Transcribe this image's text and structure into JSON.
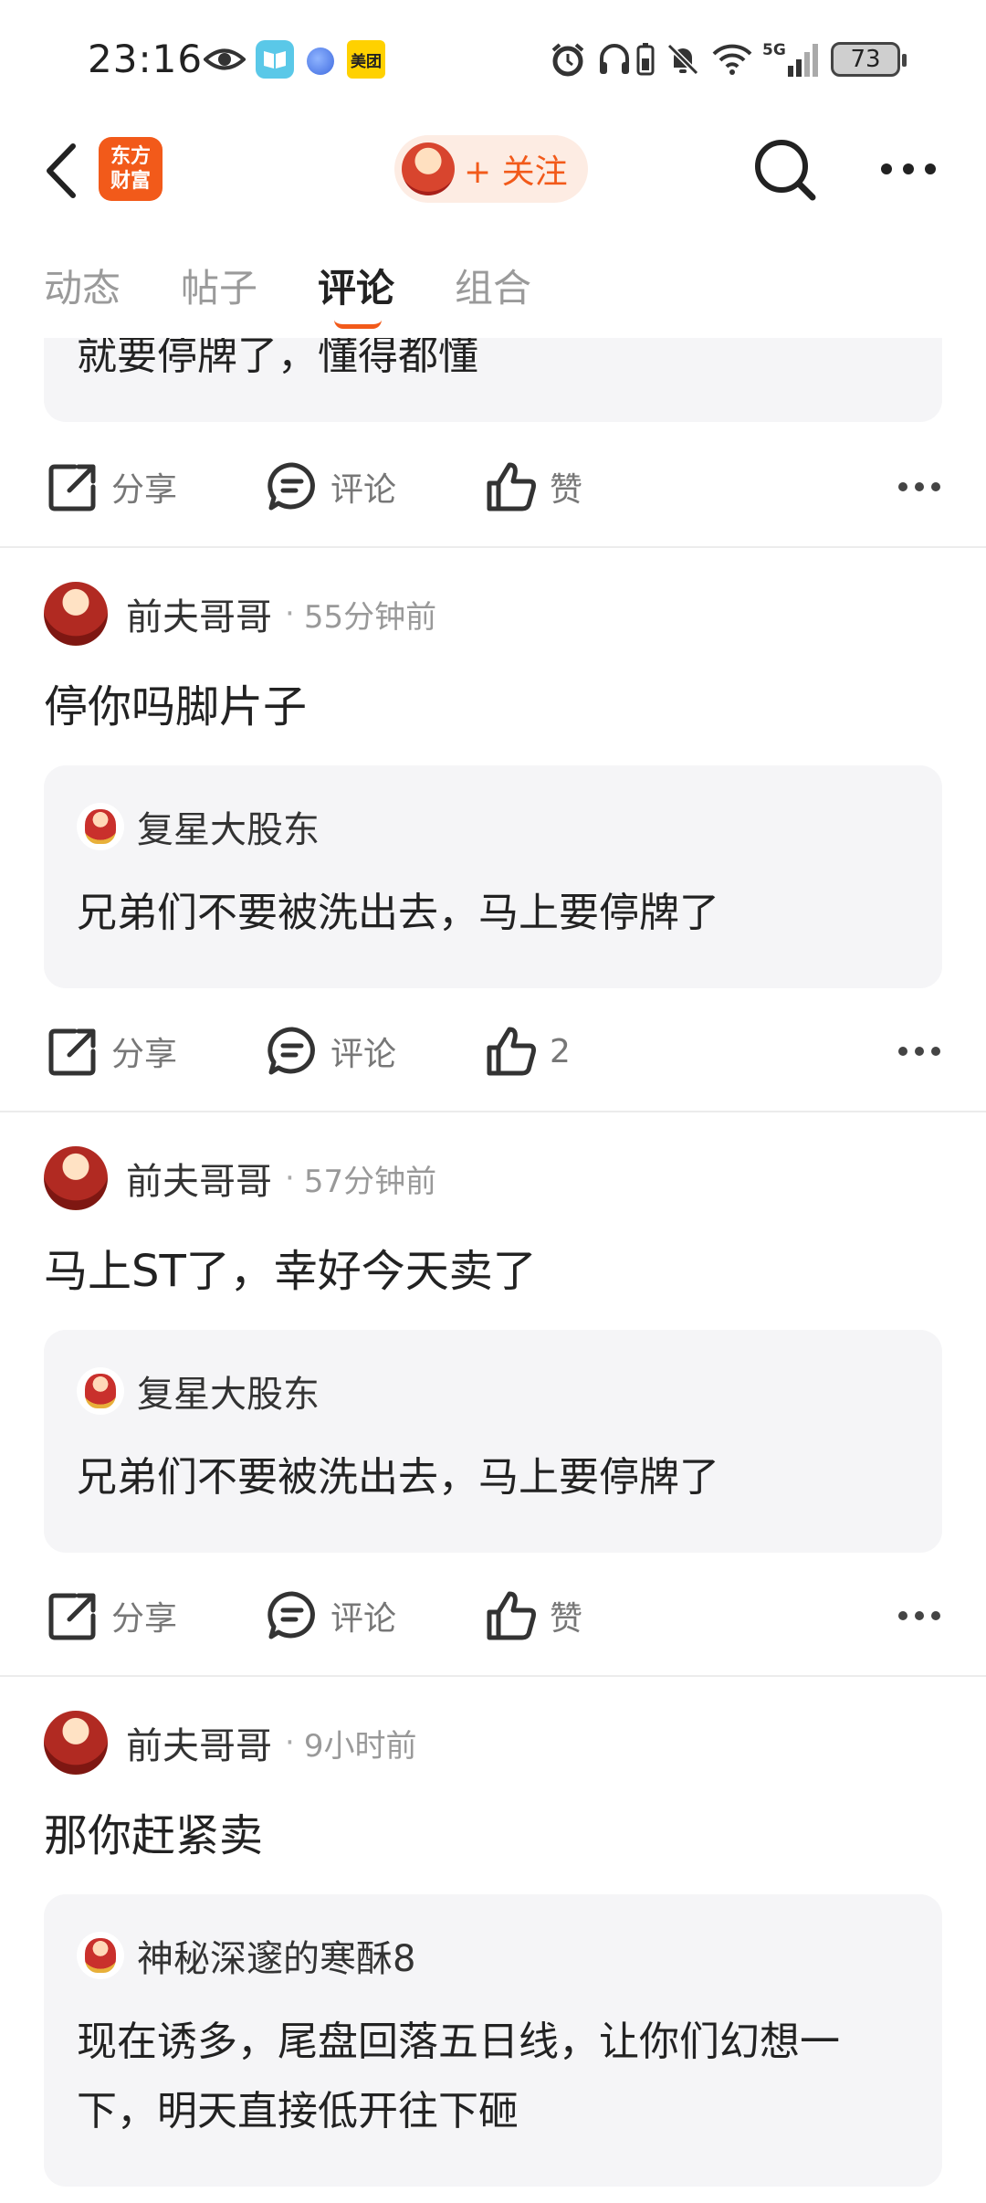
{
  "status_bar": {
    "time": "23:16",
    "app_icons": [
      "eye-icon",
      "book-app-icon",
      "dot-app-icon",
      "meituan-app-icon"
    ],
    "meituan_label": "美团",
    "right_icons": [
      "alarm-icon",
      "headphones-icon",
      "battery-saver-icon",
      "mute-icon",
      "wifi-icon",
      "signal-5g-icon"
    ],
    "network": "5G",
    "battery": "73"
  },
  "nav": {
    "logo_line1": "东方",
    "logo_line2": "财富",
    "follow_label": "+ 关注"
  },
  "tabs": [
    {
      "label": "动态",
      "active": false
    },
    {
      "label": "帖子",
      "active": false
    },
    {
      "label": "评论",
      "active": true
    },
    {
      "label": "组合",
      "active": false
    }
  ],
  "actions": {
    "share": "分享",
    "comment": "评论",
    "like": "赞"
  },
  "top_partial": {
    "quote_text": "就要停牌了，懂得都懂"
  },
  "posts": [
    {
      "author": "前夫哥哥",
      "time": "55分钟前",
      "text": "停你吗脚片子",
      "quote_author": "复星大股东",
      "quote_text": "兄弟们不要被洗出去，马上要停牌了",
      "like_label": "2"
    },
    {
      "author": "前夫哥哥",
      "time": "57分钟前",
      "text": "马上ST了，幸好今天卖了",
      "quote_author": "复星大股东",
      "quote_text": "兄弟们不要被洗出去，马上要停牌了",
      "like_label": "赞"
    },
    {
      "author": "前夫哥哥",
      "time": "9小时前",
      "text": "那你赶紧卖",
      "quote_author": "神秘深邃的寒酥8",
      "quote_text": "现在诱多，尾盘回落五日线，让你们幻想一下，明天直接低开往下砸"
    }
  ],
  "colors": {
    "accent": "#f25a1a",
    "card_bg": "#f5f5f7",
    "muted_text": "#999999"
  }
}
